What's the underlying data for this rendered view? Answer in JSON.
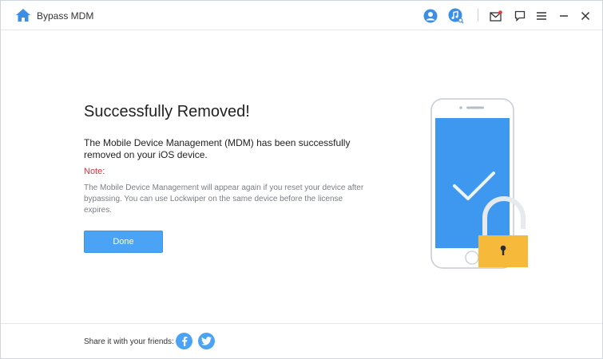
{
  "app": {
    "title": "Bypass MDM"
  },
  "titlebar": {
    "icons": [
      "home-icon",
      "account-icon",
      "music-search-icon",
      "mail-icon",
      "feedback-icon",
      "menu-icon",
      "minimize-icon",
      "close-icon"
    ]
  },
  "main": {
    "heading": "Successfully Removed!",
    "description": "The Mobile Device Management (MDM) has been successfully removed on your iOS device.",
    "note_label": "Note:",
    "note_text": "The Mobile Device Management will appear again if you reset your device after bypassing. You can use Lockwiper on the same device before the license expires.",
    "done_label": "Done"
  },
  "footer": {
    "share_label": "Share it with your friends:",
    "social": [
      "facebook-icon",
      "twitter-icon"
    ]
  },
  "colors": {
    "accent": "#4aa3f5",
    "note_red": "#d9333f",
    "lock_yellow": "#f6b93a",
    "screen_blue": "#3f98f0"
  }
}
